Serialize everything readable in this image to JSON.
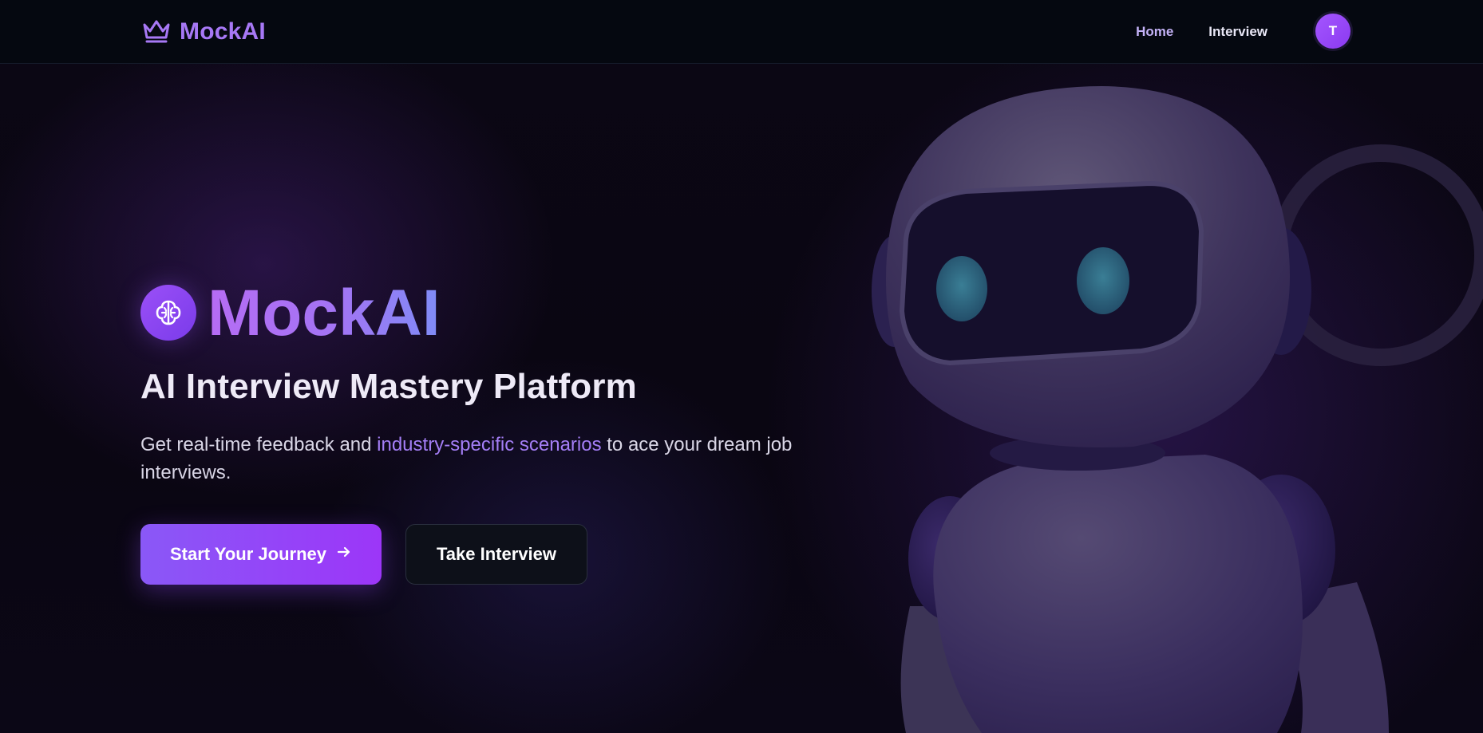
{
  "nav": {
    "brand_name": "MockAI",
    "brand_icon": "crown-icon",
    "links": [
      {
        "label": "Home",
        "active": true
      },
      {
        "label": "Interview",
        "active": false
      }
    ],
    "avatar_initial": "T"
  },
  "hero": {
    "icon": "brain-icon",
    "title": "MockAI",
    "subtitle": "AI Interview Mastery Platform",
    "description_before": "Get real-time feedback and ",
    "description_highlight": "industry-specific scenarios",
    "description_after": " to ace your dream job interviews.",
    "primary_cta": "Start Your Journey",
    "secondary_cta": "Take Interview"
  },
  "colors": {
    "accent": "#a778f5",
    "primary_button": "#8a58f7",
    "background": "#06060f"
  }
}
